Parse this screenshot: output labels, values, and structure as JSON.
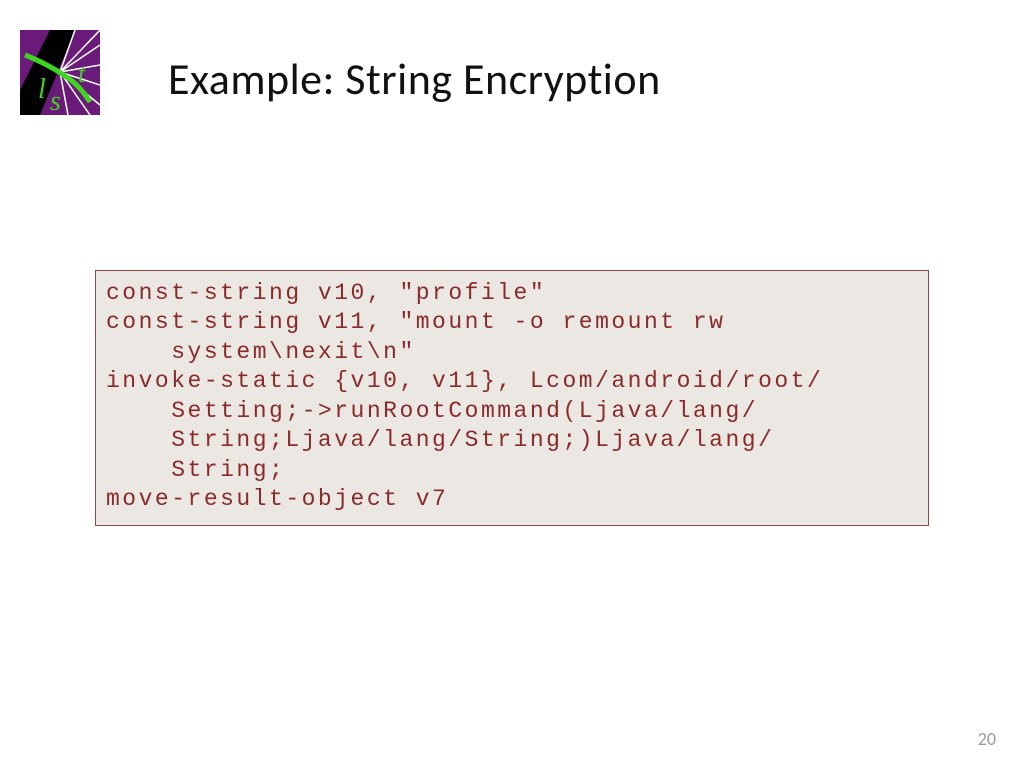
{
  "title": "Example: String Encryption",
  "code": "const-string v10, \"profile\"\nconst-string v11, \"mount -o remount rw\n    system\\nexit\\n\"\ninvoke-static {v10, v11}, Lcom/android/root/\n    Setting;->runRootCommand(Ljava/lang/\n    String;Ljava/lang/String;)Ljava/lang/\n    String;\nmove-result-object v7",
  "page_number": "20",
  "logo": {
    "alt": "list-logo"
  }
}
